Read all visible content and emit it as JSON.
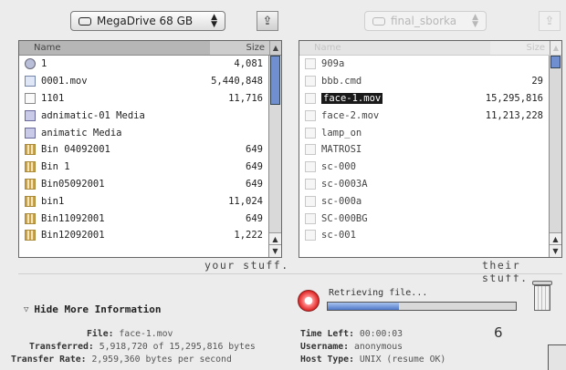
{
  "left_popup": {
    "label": "MegaDrive 68 GB"
  },
  "right_popup": {
    "label": "final_sborka"
  },
  "column_headers": {
    "name": "Name",
    "size": "Size"
  },
  "left_files": [
    {
      "name": "1",
      "size": "4,081",
      "icon": "globe-icon"
    },
    {
      "name": "0001.mov",
      "size": "5,440,848",
      "icon": "movie-icon"
    },
    {
      "name": "1101",
      "size": "11,716",
      "icon": "document-icon"
    },
    {
      "name": "adnimatic-01 Media",
      "size": "",
      "icon": "media-folder-icon"
    },
    {
      "name": "animatic Media",
      "size": "",
      "icon": "media-folder-icon"
    },
    {
      "name": "Bin 04092001",
      "size": "649",
      "icon": "bin-icon"
    },
    {
      "name": "Bin 1",
      "size": "649",
      "icon": "bin-icon"
    },
    {
      "name": "Bin05092001",
      "size": "649",
      "icon": "bin-icon"
    },
    {
      "name": "bin1",
      "size": "11,024",
      "icon": "bin-icon"
    },
    {
      "name": "Bin11092001",
      "size": "649",
      "icon": "bin-icon"
    },
    {
      "name": "Bin12092001",
      "size": "1,222",
      "icon": "bin-icon"
    }
  ],
  "right_files": [
    {
      "name": "909a",
      "size": "",
      "icon": "file-icon"
    },
    {
      "name": "bbb.cmd",
      "size": "29",
      "icon": "file-icon"
    },
    {
      "name": "face-1.mov",
      "size": "15,295,816",
      "icon": "file-icon",
      "selected": true
    },
    {
      "name": "face-2.mov",
      "size": "11,213,228",
      "icon": "file-icon"
    },
    {
      "name": "lamp_on",
      "size": "",
      "icon": "file-icon"
    },
    {
      "name": "MATROSI",
      "size": "",
      "icon": "file-icon"
    },
    {
      "name": "sc-000",
      "size": "",
      "icon": "file-icon"
    },
    {
      "name": "sc-0003A",
      "size": "",
      "icon": "file-icon"
    },
    {
      "name": "sc-000a",
      "size": "",
      "icon": "file-icon"
    },
    {
      "name": "SC-000BG",
      "size": "",
      "icon": "file-icon"
    },
    {
      "name": "sc-001",
      "size": "",
      "icon": "file-icon"
    }
  ],
  "left_tagline": "your stuff.",
  "right_tagline": "their stuff.",
  "hide_more_label": "Hide More Information",
  "progress": {
    "label": "Retrieving file...",
    "fraction": 0.38
  },
  "transfer_info": {
    "file_label": "File:",
    "file_value": "face-1.mov",
    "transferred_label": "Transferred:",
    "transferred_value": "5,918,720 of 15,295,816 bytes",
    "rate_label": "Transfer Rate:",
    "rate_value": "2,959,360 bytes per second",
    "time_left_label": "Time Left:",
    "time_left_value": "00:00:03",
    "username_label": "Username:",
    "username_value": "anonymous",
    "host_type_label": "Host Type:",
    "host_type_value": "UNIX (resume OK)"
  },
  "page_number": "6",
  "colors": {
    "progress_fill": "#4e78c8",
    "stop_button": "#e02424",
    "selection": "#1a1a1a"
  }
}
